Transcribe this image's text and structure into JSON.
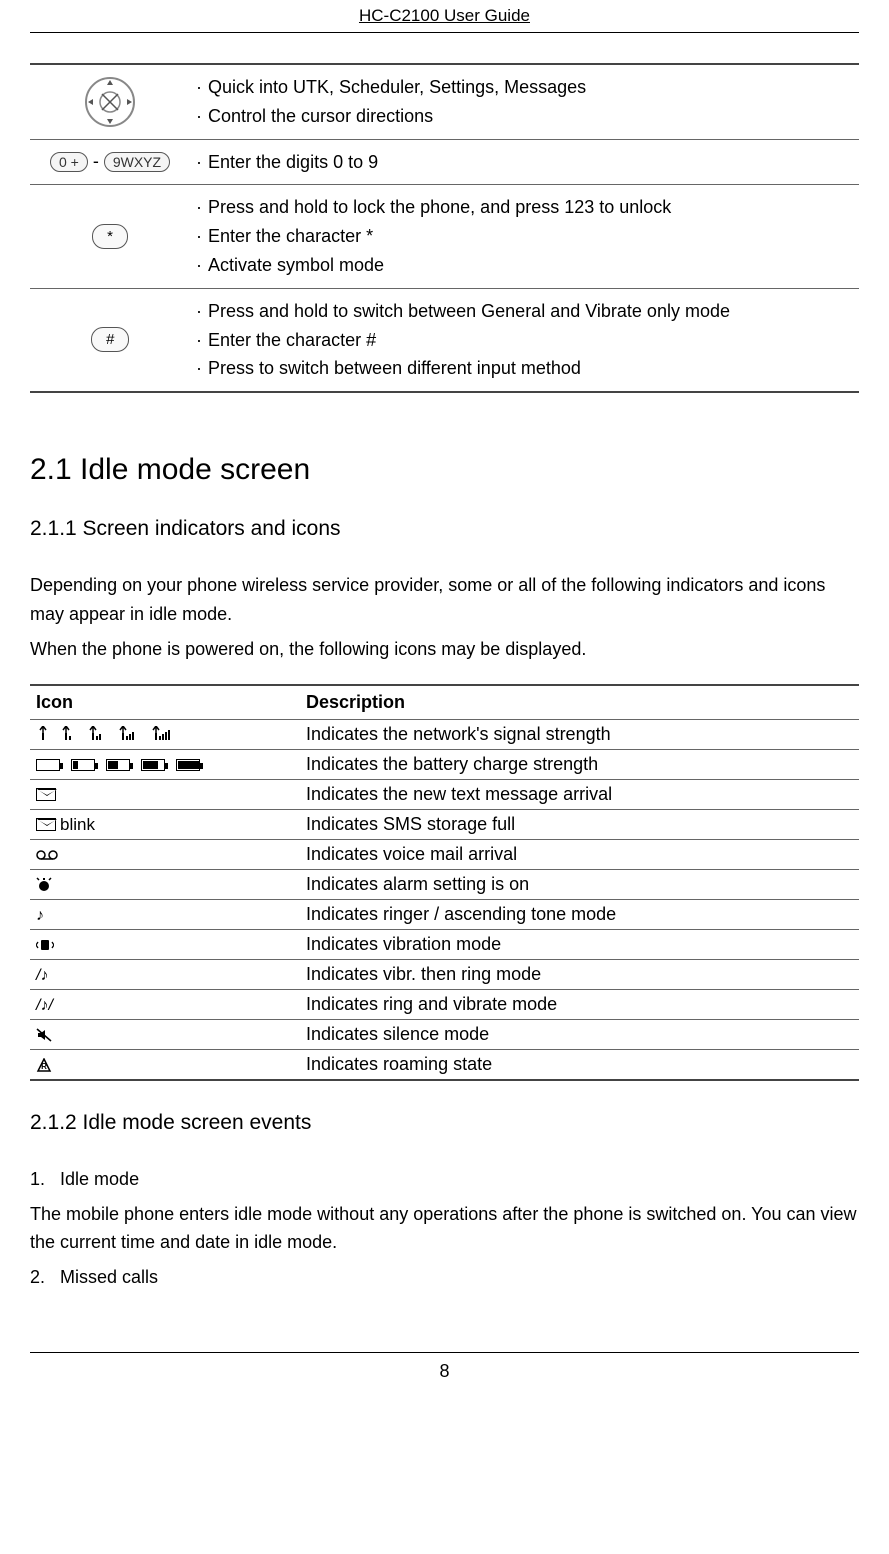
{
  "header": {
    "title": "HC-C2100 User Guide"
  },
  "keys": [
    {
      "desc": [
        "Quick into UTK, Scheduler, Settings, Messages",
        "Control the cursor directions"
      ]
    },
    {
      "desc": [
        "Enter the digits 0 to 9"
      ]
    },
    {
      "desc": [
        "Press and hold to lock the phone, and press 123 to unlock",
        "Enter the character *",
        "Activate symbol mode"
      ]
    },
    {
      "desc": [
        "Press and hold to switch between General and Vibrate only mode",
        "Enter the character #",
        "Press to switch between different input method"
      ]
    }
  ],
  "section": {
    "title": "2.1 Idle mode screen"
  },
  "subsection1": {
    "title": "2.1.1 Screen indicators and icons"
  },
  "para1": "Depending on your phone wireless service provider, some or all of the following indicators and icons may appear in idle mode.",
  "para2": "When the phone is powered on, the following icons may be displayed.",
  "iconTable": {
    "headers": {
      "c1": "Icon",
      "c2": "Description"
    },
    "rows": [
      {
        "label": "",
        "desc": "Indicates the network's signal strength"
      },
      {
        "label": "",
        "desc": "Indicates the battery charge strength"
      },
      {
        "label": "",
        "desc": "Indicates the new text message arrival"
      },
      {
        "label": "blink",
        "desc": "Indicates SMS storage full"
      },
      {
        "label": "",
        "desc": "Indicates voice mail arrival"
      },
      {
        "label": "",
        "desc": "Indicates alarm setting is on"
      },
      {
        "label": "",
        "desc": "Indicates ringer / ascending tone mode"
      },
      {
        "label": "",
        "desc": "Indicates vibration mode"
      },
      {
        "label": "",
        "desc": "Indicates vibr. then ring mode"
      },
      {
        "label": "",
        "desc": "Indicates ring and vibrate mode"
      },
      {
        "label": "",
        "desc": "Indicates silence mode"
      },
      {
        "label": "",
        "desc": "Indicates roaming state"
      }
    ]
  },
  "subsection2": {
    "title": "2.1.2 Idle mode screen events"
  },
  "list1": {
    "num": "1.",
    "title": "Idle mode"
  },
  "para3": "The mobile phone enters idle mode without any operations after the phone is switched on. You can view the current time and date in idle mode.",
  "list2": {
    "num": "2.",
    "title": "Missed calls"
  },
  "pageNumber": "8",
  "keyLabels": {
    "zero": "0 +",
    "nine": "9WXYZ",
    "star": "*",
    "hash": "#",
    "dash": "-"
  }
}
